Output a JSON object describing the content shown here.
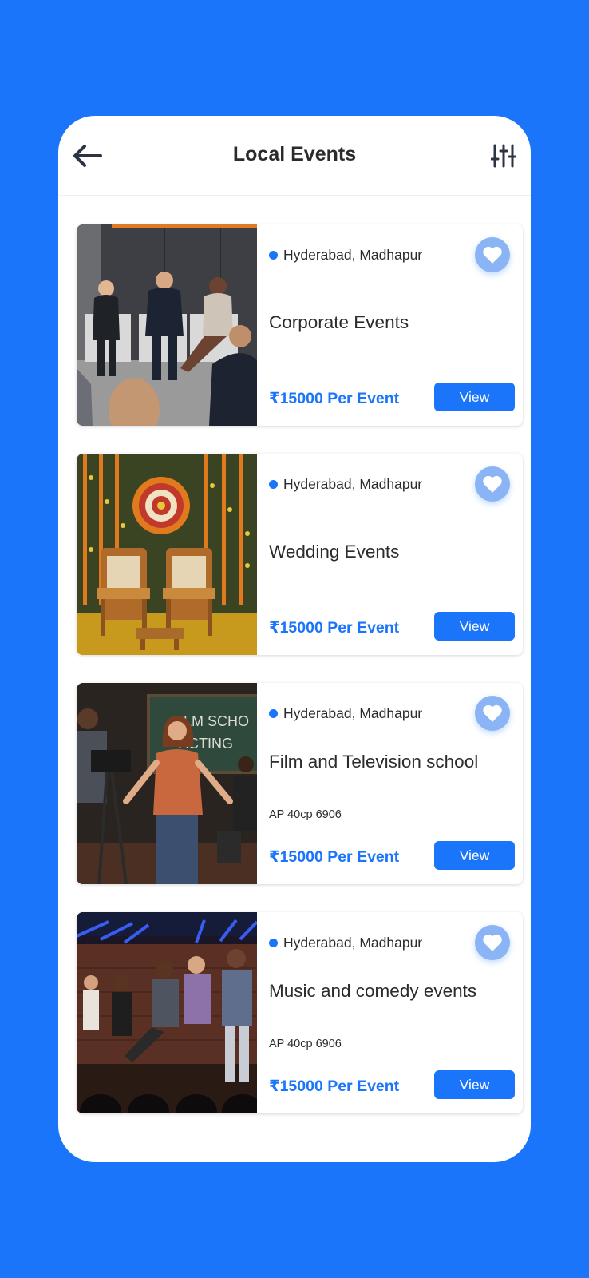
{
  "header": {
    "title": "Local Events",
    "back_icon": "arrow-left-icon",
    "filter_icon": "sliders-icon"
  },
  "colors": {
    "background": "#1a75fa",
    "accent": "#1a75fa",
    "favorite": "#8ab4f4",
    "text": "#2b2b2b"
  },
  "events": [
    {
      "location": "Hyderabad, Madhapur",
      "name": "Corporate Events",
      "price": "₹15000 Per Event",
      "view_label": "View",
      "favorite_icon": "heart-icon"
    },
    {
      "location": "Hyderabad, Madhapur",
      "name": "Wedding Events",
      "price": "₹15000 Per Event",
      "view_label": "View",
      "favorite_icon": "heart-icon"
    },
    {
      "location": "Hyderabad, Madhapur",
      "name": "Film and  Television  school",
      "code": "AP 40cp 6906",
      "price": "₹15000 Per Event",
      "view_label": "View",
      "favorite_icon": "heart-icon",
      "image_text": "FILM SCHO ACTING"
    },
    {
      "location": "Hyderabad, Madhapur",
      "name": "Music and comedy events",
      "code": "AP 40cp 6906",
      "price": "₹15000 Per Event",
      "view_label": "View",
      "favorite_icon": "heart-icon"
    }
  ]
}
